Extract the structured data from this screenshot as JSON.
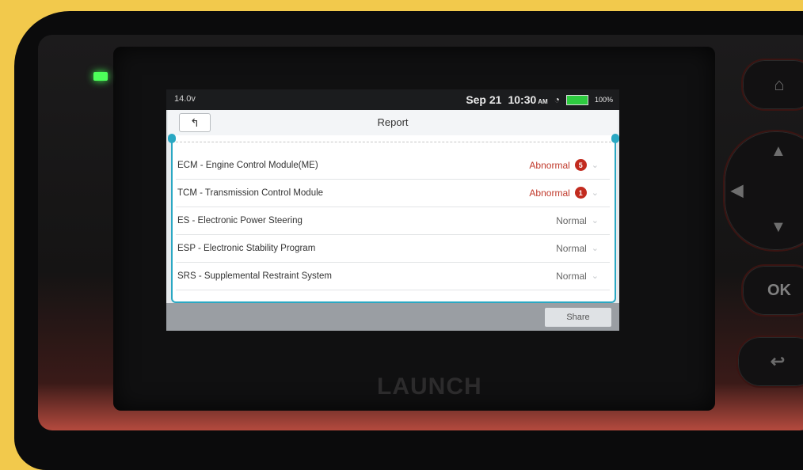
{
  "device": {
    "brand": "LAUNCH",
    "ok_label": "OK"
  },
  "status_bar": {
    "voltage": "14.0v",
    "date": "Sep 21",
    "time": "10:30",
    "ampm": "AM",
    "battery": "100%"
  },
  "titlebar": {
    "title": "Report"
  },
  "modules": [
    {
      "name": "ECM - Engine Control Module(ME)",
      "status": "Abnormal",
      "count": "5",
      "abnormal": true
    },
    {
      "name": "TCM - Transmission Control Module",
      "status": "Abnormal",
      "count": "1",
      "abnormal": true
    },
    {
      "name": "ES - Electronic Power Steering",
      "status": "Normal",
      "count": null,
      "abnormal": false
    },
    {
      "name": "ESP - Electronic Stability Program",
      "status": "Normal",
      "count": null,
      "abnormal": false
    },
    {
      "name": "SRS - Supplemental Restraint System",
      "status": "Normal",
      "count": null,
      "abnormal": false
    }
  ],
  "bottom_bar": {
    "share_label": "Share"
  },
  "colors": {
    "accent": "#2aa8c3",
    "abnormal": "#c22b1f",
    "frame": "#f2c94c"
  }
}
